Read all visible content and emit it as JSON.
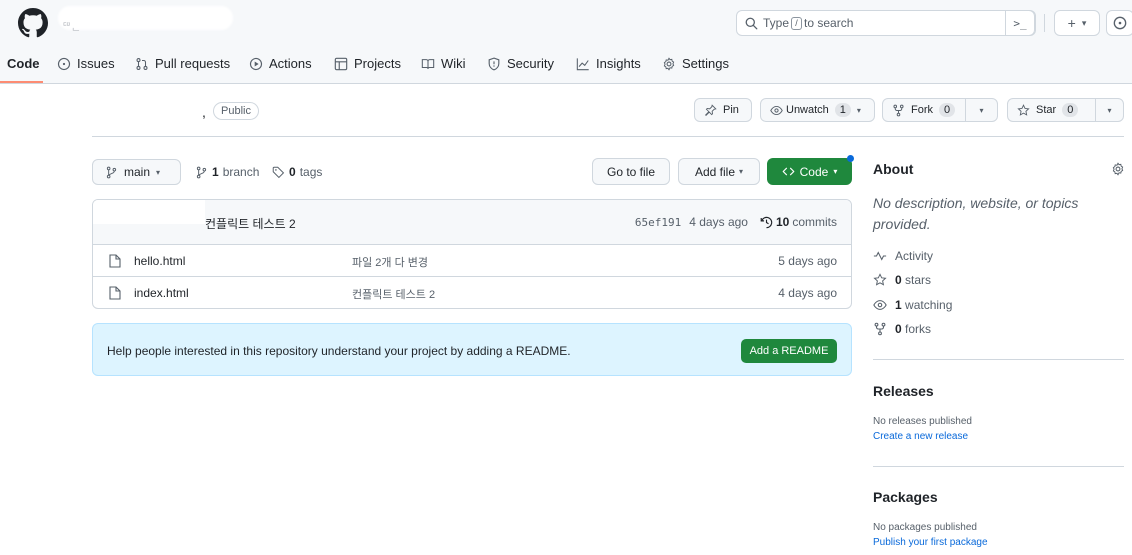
{
  "header": {
    "owner_text": "ᄃᄆᆫ",
    "search_prefix": "Type",
    "search_key": "/",
    "search_suffix": "to search",
    "command_symbol": ">_",
    "plus_symbol": "+",
    "caret": "▾"
  },
  "tabs": [
    {
      "label": "Code",
      "icon": "code-icon"
    },
    {
      "label": "Issues",
      "icon": "issue-icon"
    },
    {
      "label": "Pull requests",
      "icon": "pull-request-icon"
    },
    {
      "label": "Actions",
      "icon": "play-icon"
    },
    {
      "label": "Projects",
      "icon": "table-icon"
    },
    {
      "label": "Wiki",
      "icon": "book-icon"
    },
    {
      "label": "Security",
      "icon": "shield-icon"
    },
    {
      "label": "Insights",
      "icon": "graph-icon"
    },
    {
      "label": "Settings",
      "icon": "gear-icon"
    }
  ],
  "repo": {
    "comma": ",",
    "visibility": "Public",
    "pin_label": "Pin",
    "unwatch_label": "Unwatch",
    "unwatch_count": "1",
    "fork_label": "Fork",
    "fork_count": "0",
    "star_label": "Star",
    "star_count": "0"
  },
  "branch_bar": {
    "branch_name": "main",
    "branch_count": "1",
    "branch_word": "branch",
    "tag_count": "0",
    "tag_word": "tags",
    "go_to_file": "Go to file",
    "add_file": "Add file",
    "code_label": "Code"
  },
  "latest_commit": {
    "message": "컨플릭트 테스트 2",
    "sha": "65ef191",
    "age": "4 days ago",
    "commit_count": "10",
    "commit_word": "commits"
  },
  "files": [
    {
      "name": "hello.html",
      "message": "파일 2개 다 변경",
      "date": "5 days ago"
    },
    {
      "name": "index.html",
      "message": "컨플릭트 테스트 2",
      "date": "4 days ago"
    }
  ],
  "readme_banner": {
    "text": "Help people interested in this repository understand your project by adding a README.",
    "button": "Add a README"
  },
  "about": {
    "heading": "About",
    "description": "No description, website, or topics provided.",
    "activity": "Activity",
    "stars_count": "0",
    "stars_word": "stars",
    "watching_count": "1",
    "watching_word": "watching",
    "forks_count": "0",
    "forks_word": "forks"
  },
  "releases": {
    "heading": "Releases",
    "note": "No releases published",
    "link": "Create a new release"
  },
  "packages": {
    "heading": "Packages",
    "note": "No packages published",
    "link": "Publish your first package"
  },
  "colors": {
    "primary_green": "#1f883d",
    "link_blue": "#0969da",
    "active_tab_underline": "#fd8c73",
    "banner_bg": "#ddf4ff"
  }
}
